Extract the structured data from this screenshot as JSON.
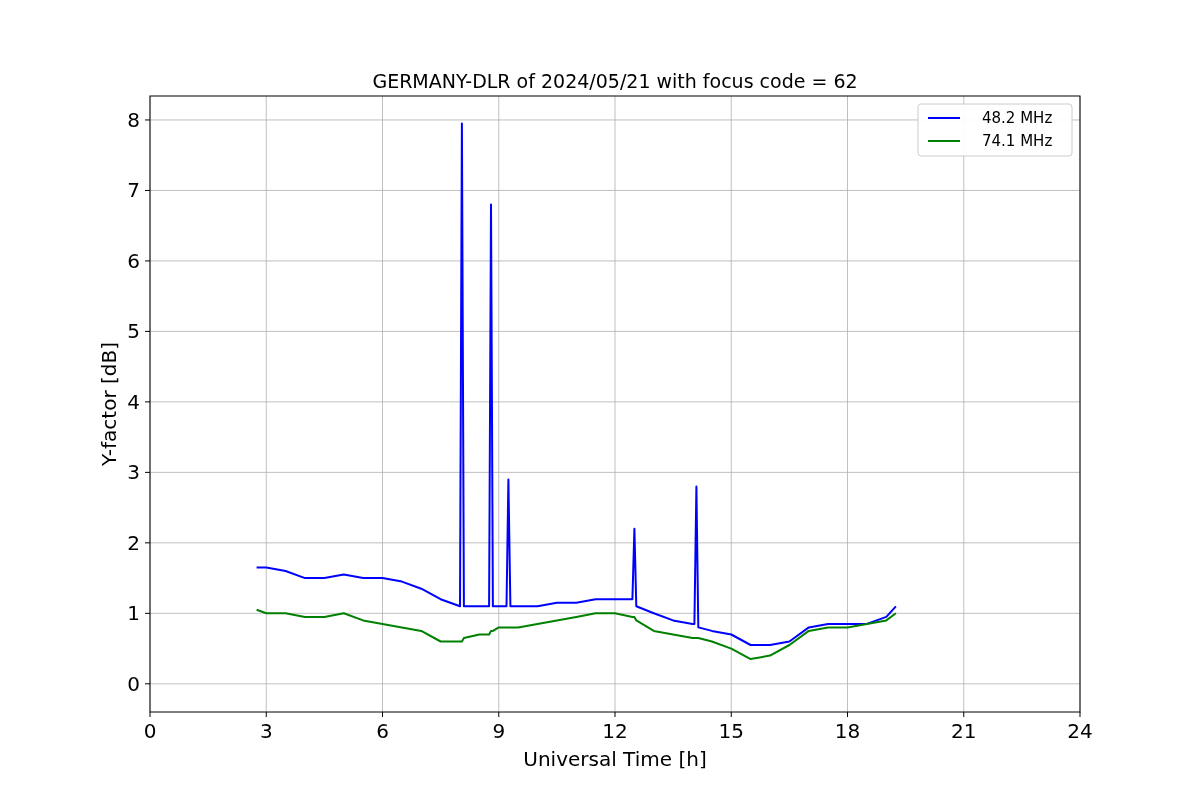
{
  "figure": {
    "chart_data": {
      "type": "line",
      "title": "GERMANY-DLR of 2024/05/21 with focus code = 62",
      "xlabel": "Universal Time [h]",
      "ylabel": "Y-factor [dB]",
      "x": [
        2.75,
        3,
        3.5,
        4,
        4.5,
        5,
        5.5,
        6,
        6.5,
        7,
        7.5,
        8,
        8.05,
        8.1,
        8.5,
        8.75,
        8.8,
        8.85,
        9,
        9.2,
        9.25,
        9.3,
        9.5,
        10,
        10.5,
        11,
        11.5,
        12,
        12.45,
        12.5,
        12.55,
        13,
        13.5,
        14,
        14.05,
        14.1,
        14.15,
        14.5,
        15,
        15.5,
        16,
        16.5,
        17,
        17.5,
        18,
        18.5,
        19,
        19.25
      ],
      "series": [
        {
          "name": "48.2 MHz",
          "color": "#0000ff",
          "values": [
            1.65,
            1.65,
            1.6,
            1.5,
            1.5,
            1.55,
            1.5,
            1.5,
            1.45,
            1.35,
            1.2,
            1.1,
            7.95,
            1.1,
            1.1,
            1.1,
            6.8,
            1.1,
            1.1,
            1.1,
            2.9,
            1.1,
            1.1,
            1.1,
            1.15,
            1.15,
            1.2,
            1.2,
            1.2,
            2.2,
            1.1,
            1.0,
            0.9,
            0.85,
            0.85,
            2.8,
            0.8,
            0.75,
            0.7,
            0.55,
            0.55,
            0.6,
            0.8,
            0.85,
            0.85,
            0.85,
            0.95,
            1.1
          ]
        },
        {
          "name": "74.1 MHz",
          "color": "#008000",
          "values": [
            1.05,
            1.0,
            1.0,
            0.95,
            0.95,
            1.0,
            0.9,
            0.85,
            0.8,
            0.75,
            0.6,
            0.6,
            0.6,
            0.65,
            0.7,
            0.7,
            0.75,
            0.75,
            0.8,
            0.8,
            0.8,
            0.8,
            0.8,
            0.85,
            0.9,
            0.95,
            1.0,
            1.0,
            0.95,
            0.95,
            0.9,
            0.75,
            0.7,
            0.65,
            0.65,
            0.65,
            0.65,
            0.6,
            0.5,
            0.35,
            0.4,
            0.55,
            0.75,
            0.8,
            0.8,
            0.85,
            0.9,
            1.0
          ]
        }
      ],
      "xlim": [
        0,
        24
      ],
      "ylim": [
        -0.4,
        8.34
      ],
      "grid": true,
      "legend": true,
      "xticks": [
        0,
        3,
        6,
        9,
        12,
        15,
        18,
        21,
        24
      ],
      "yticks": [
        0,
        1,
        2,
        3,
        4,
        5,
        6,
        7,
        8
      ]
    }
  }
}
